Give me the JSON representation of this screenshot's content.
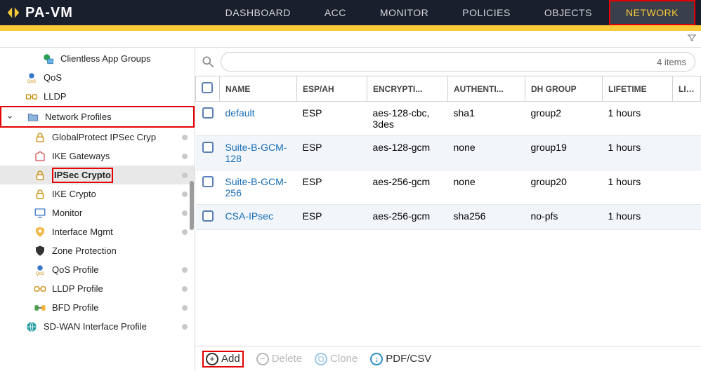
{
  "brand": {
    "name": "PA-VM"
  },
  "nav": {
    "dashboard": "DASHBOARD",
    "acc": "ACC",
    "monitor": "MONITOR",
    "policies": "POLICIES",
    "objects": "OBJECTS",
    "network": "NETWORK"
  },
  "sidebar": [
    {
      "id": "clientless-app-groups",
      "label": "Clientless App Groups",
      "depth": 2,
      "icon": "globe-stack"
    },
    {
      "id": "qos",
      "label": "QoS",
      "depth": 0,
      "icon": "qos"
    },
    {
      "id": "lldp",
      "label": "LLDP",
      "depth": 0,
      "icon": "lldp"
    },
    {
      "id": "network-profiles",
      "label": "Network Profiles",
      "depth": 0,
      "icon": "folder",
      "caret": true,
      "highlight": true
    },
    {
      "id": "gp-ipsec-crypto",
      "label": "GlobalProtect IPSec Crypto",
      "depth": 1,
      "icon": "lock",
      "truncated": "GlobalProtect IPSec Cryp",
      "dot": true
    },
    {
      "id": "ike-gateways",
      "label": "IKE Gateways",
      "depth": 1,
      "icon": "gateway",
      "dot": true
    },
    {
      "id": "ipsec-crypto",
      "label": "IPSec Crypto",
      "depth": 1,
      "icon": "lock",
      "selected": true,
      "dot": true,
      "highlight": true
    },
    {
      "id": "ike-crypto",
      "label": "IKE Crypto",
      "depth": 1,
      "icon": "lock",
      "dot": true
    },
    {
      "id": "monitor-prof",
      "label": "Monitor",
      "depth": 1,
      "icon": "monitor",
      "dot": true
    },
    {
      "id": "interface-mgmt",
      "label": "Interface Mgmt",
      "depth": 1,
      "icon": "gear-shield",
      "dot": true
    },
    {
      "id": "zone-protection",
      "label": "Zone Protection",
      "depth": 1,
      "icon": "shield"
    },
    {
      "id": "qos-profile",
      "label": "QoS Profile",
      "depth": 1,
      "icon": "qos",
      "dot": true
    },
    {
      "id": "lldp-profile",
      "label": "LLDP Profile",
      "depth": 1,
      "icon": "lldp",
      "dot": true
    },
    {
      "id": "bfd-profile",
      "label": "BFD Profile",
      "depth": 1,
      "icon": "bfd",
      "dot": true
    },
    {
      "id": "sdwan-interface-profile",
      "label": "SD-WAN Interface Profile",
      "depth": 0,
      "icon": "globe",
      "dot": true
    }
  ],
  "search": {
    "count_label": "4 items"
  },
  "columns": {
    "name": "NAME",
    "espah": "ESP/AH",
    "encryption": "ENCRYPTI...",
    "authentication": "AUTHENTI...",
    "dhgroup": "DH GROUP",
    "lifetime": "LIFETIME",
    "life2": "LIFE"
  },
  "rows": [
    {
      "name": "default",
      "espah": "ESP",
      "encryption": "aes-128-cbc, 3des",
      "auth": "sha1",
      "dh": "group2",
      "lifetime": "1 hours"
    },
    {
      "name": "Suite-B-GCM-128",
      "espah": "ESP",
      "encryption": "aes-128-gcm",
      "auth": "none",
      "dh": "group19",
      "lifetime": "1 hours"
    },
    {
      "name": "Suite-B-GCM-256",
      "espah": "ESP",
      "encryption": "aes-256-gcm",
      "auth": "none",
      "dh": "group20",
      "lifetime": "1 hours"
    },
    {
      "name": "CSA-IPsec",
      "espah": "ESP",
      "encryption": "aes-256-gcm",
      "auth": "sha256",
      "dh": "no-pfs",
      "lifetime": "1 hours"
    }
  ],
  "toolbar": {
    "add": "Add",
    "delete": "Delete",
    "clone": "Clone",
    "pdfcsv": "PDF/CSV"
  }
}
